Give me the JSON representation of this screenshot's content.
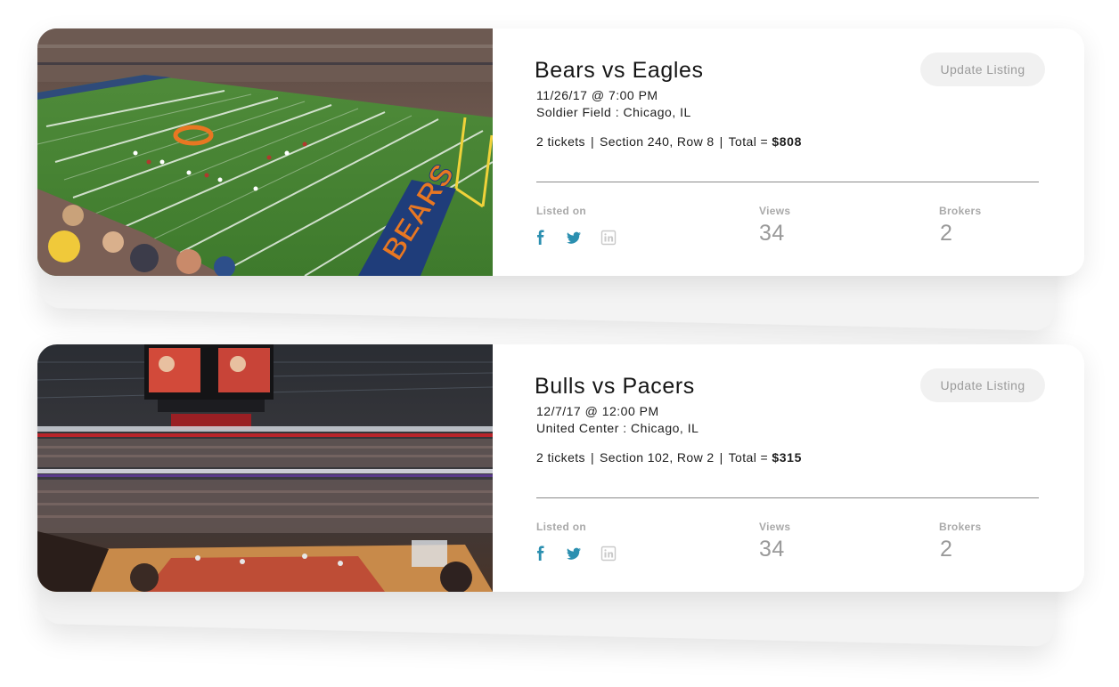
{
  "listings": [
    {
      "title": "Bears vs Eagles",
      "datetime": "11/26/17 @ 7:00 PM",
      "venue": "Soldier Field : Chicago, IL",
      "tickets": "2 tickets",
      "seat": "Section 240, Row 8",
      "total_label": "Total =",
      "total": "$808",
      "update_label": "Update Listing",
      "listed_on_label": "Listed on",
      "views_label": "Views",
      "views": "34",
      "brokers_label": "Brokers",
      "brokers": "2",
      "photo": "football-stadium-photo"
    },
    {
      "title": "Bulls vs Pacers",
      "datetime": "12/7/17 @ 12:00 PM",
      "venue": "United Center : Chicago, IL",
      "tickets": "2 tickets",
      "seat": "Section 102, Row 2",
      "total_label": "Total =",
      "total": "$315",
      "update_label": "Update Listing",
      "listed_on_label": "Listed on",
      "views_label": "Views",
      "views": "34",
      "brokers_label": "Brokers",
      "brokers": "2",
      "photo": "basketball-arena-photo"
    }
  ],
  "separator": "|",
  "icons": {
    "facebook": "facebook-icon",
    "twitter": "twitter-icon",
    "linkedin": "linkedin-icon"
  },
  "colors": {
    "social_active": "#2b8fb0",
    "social_inactive": "#c9c9c9",
    "button_bg": "#f1f1f1",
    "button_text": "#9b9b9b",
    "muted_text": "#a9a9a9"
  }
}
